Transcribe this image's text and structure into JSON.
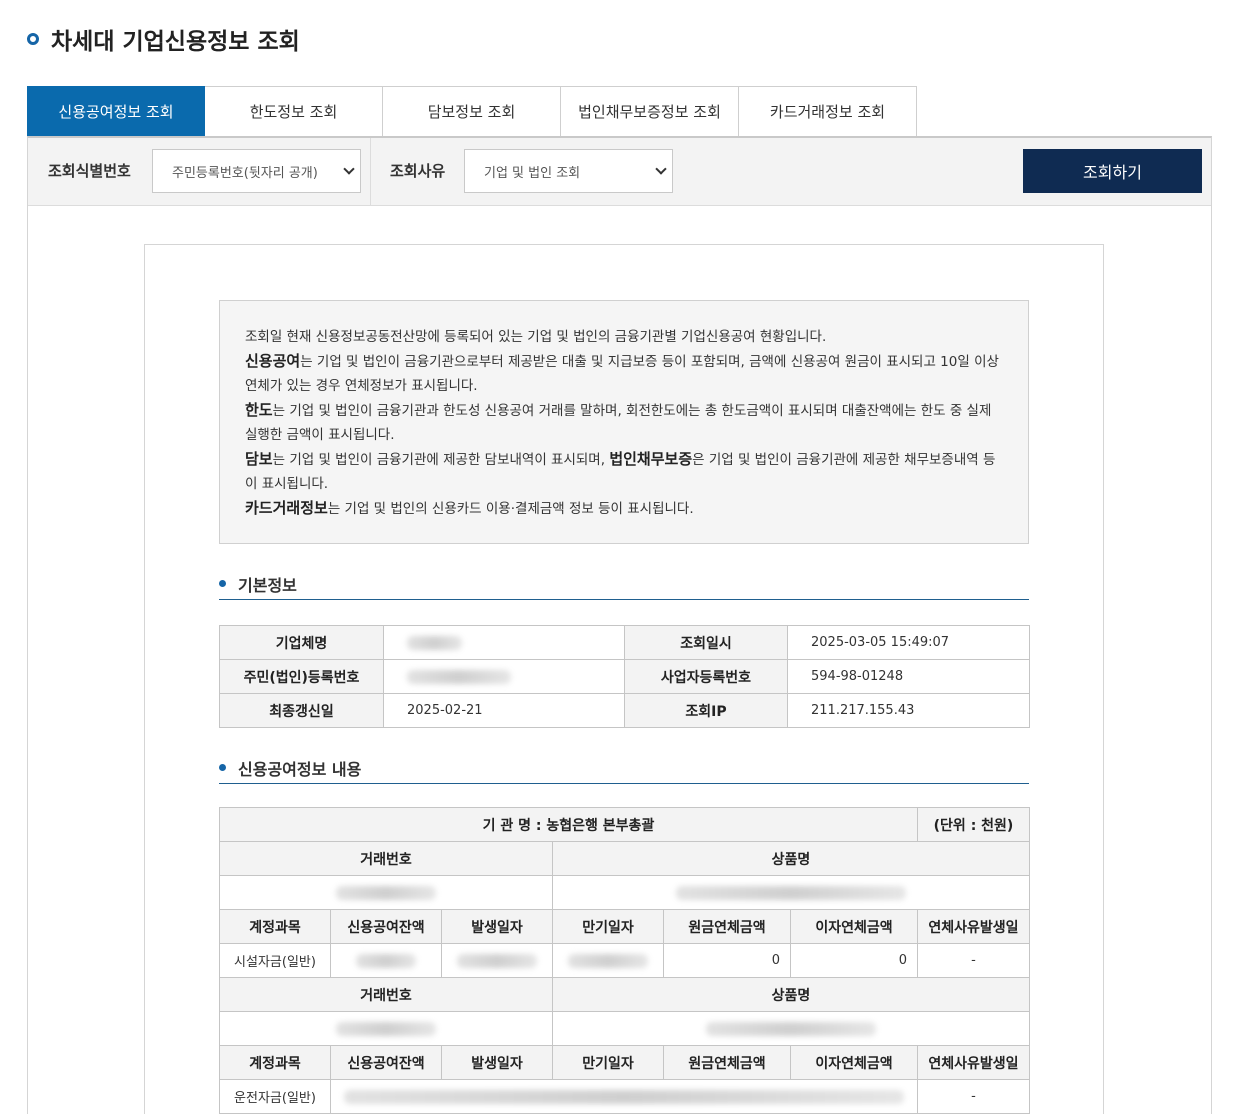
{
  "page": {
    "title": "차세대 기업신용정보 조회"
  },
  "tabs": [
    {
      "label": "신용공여정보 조회",
      "active": true
    },
    {
      "label": "한도정보 조회"
    },
    {
      "label": "담보정보 조회"
    },
    {
      "label": "법인채무보증정보 조회"
    },
    {
      "label": "카드거래정보 조회"
    }
  ],
  "search": {
    "id_label": "조회식별번호",
    "id_select_value": "주민등록번호(뒷자리 공개)",
    "reason_label": "조회사유",
    "reason_select_value": "기업 및 법인 조회",
    "button_label": "조회하기"
  },
  "notice": {
    "line1": "조회일 현재 신용정보공동전산망에 등록되어 있는 기업 및 법인의 금융기관별 기업신용공여 현황입니다.",
    "credit_term": "신용공여",
    "credit_text": "는 기업 및 법인이 금융기관으로부터 제공받은 대출 및 지급보증 등이 포함되며, 금액에 신용공여 원금이 표시되고 10일 이상 연체가 있는 경우 연체정보가 표시됩니다.",
    "limit_term": "한도",
    "limit_text": "는 기업 및 법인이 금융기관과 한도성 신용공여 거래를 말하며, 회전한도에는 총 한도금액이 표시되며 대출잔액에는 한도 중 실제 실행한 금액이 표시됩니다.",
    "collateral_term": "담보",
    "collateral_text": "는 기업 및 법인이 금융기관에 제공한 담보내역이 표시되며, ",
    "guarantee_term": "법인채무보증",
    "guarantee_text": "은 기업 및 법인이 금융기관에 제공한 채무보증내역 등이 표시됩니다.",
    "card_term": "카드거래정보",
    "card_text": "는 기업 및 법인의 신용카드 이용·결제금액 정보 등이 표시됩니다."
  },
  "basic": {
    "section_title": "기본정보",
    "company_label": "기업체명",
    "query_time_label": "조회일시",
    "query_time": "2025-03-05 15:49:07",
    "reg_no_label": "주민(법인)등록번호",
    "biz_no_label": "사업자등록번호",
    "biz_no": "594-98-01248",
    "updated_label": "최종갱신일",
    "updated": "2025-02-21",
    "ip_label": "조회IP",
    "ip": "211.217.155.43"
  },
  "credit": {
    "section_title": "신용공여정보 내용",
    "institution": "기 관 명 : 농협은행 본부총괄",
    "unit": "(단위 : 천원)",
    "txn_no_label": "거래번호",
    "product_label": "상품명",
    "col_account": "계정과목",
    "col_balance": "신용공여잔액",
    "col_issue": "발생일자",
    "col_maturity": "만기일자",
    "col_principal_overdue": "원금연체금액",
    "col_interest_overdue": "이자연체금액",
    "col_overdue_date": "연체사유발생일",
    "rows": [
      {
        "account": "시설자금(일반)",
        "principal_overdue": "0",
        "interest_overdue": "0",
        "overdue_date": "-"
      },
      {
        "account": "운전자금(일반)",
        "overdue_date": "-"
      }
    ]
  }
}
